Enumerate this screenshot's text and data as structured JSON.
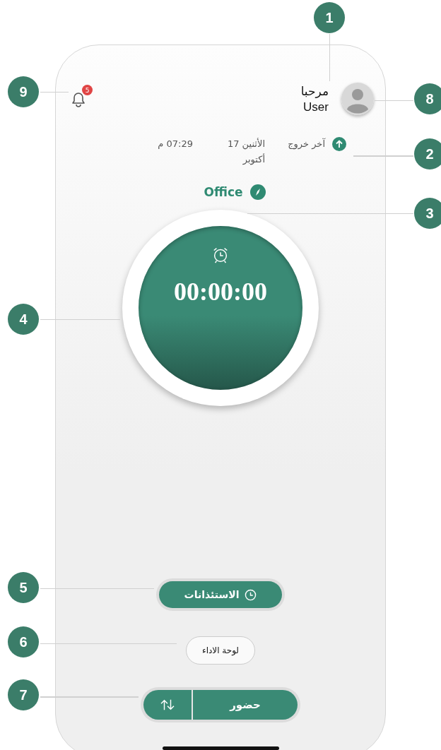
{
  "callouts": [
    {
      "label": "1"
    },
    {
      "label": "2"
    },
    {
      "label": "3"
    },
    {
      "label": "4"
    },
    {
      "label": "5"
    },
    {
      "label": "6"
    },
    {
      "label": "7"
    },
    {
      "label": "8"
    },
    {
      "label": "9"
    }
  ],
  "header": {
    "greeting": "مرحبا",
    "user_name": "User",
    "notification_count": "5"
  },
  "last_checkout": {
    "label": "آخر خروج",
    "date": "الأثنين 17 أكتوبر",
    "time": "07:29 م"
  },
  "location": {
    "name": "Office"
  },
  "timer": {
    "time": "00:00:00"
  },
  "buttons": {
    "permissions": "الاستئذانات",
    "dashboard": "لوحة الاداء",
    "attendance": "حضور"
  }
}
